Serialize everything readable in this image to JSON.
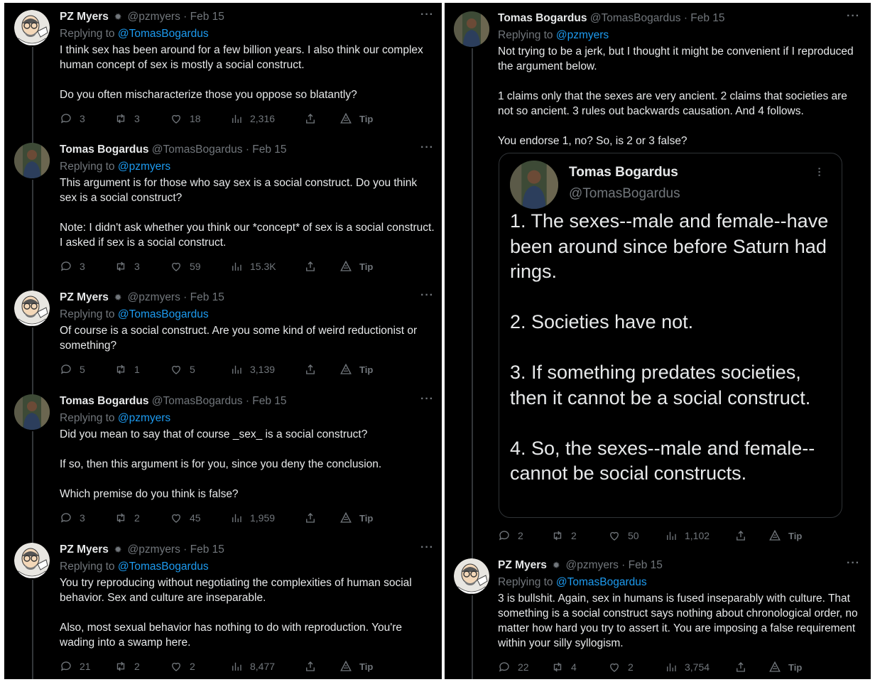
{
  "left_column": {
    "tweets": [
      {
        "name": "PZ Myers",
        "badge": "spider-icon",
        "handle": "@pzmyers",
        "date": "Feb 15",
        "replying_label": "Replying to",
        "replying_to": "@TomasBogardus",
        "body": [
          "I think sex has been around for a few billion years. I also think our complex human concept of sex is mostly a social construct.",
          "Do you often mischaracterize those you oppose so blatantly?"
        ],
        "replies": "3",
        "retweets": "3",
        "likes": "18",
        "views": "2,316",
        "tip": "Tip"
      },
      {
        "name": "Tomas Bogardus",
        "badge": "",
        "handle": "@TomasBogardus",
        "date": "Feb 15",
        "replying_label": "Replying to",
        "replying_to": "@pzmyers",
        "body": [
          "This argument is for those who say sex is a social construct. Do you think sex is a social construct?",
          "Note: I didn't ask whether you think our *concept* of sex is a social construct. I asked if sex is a social construct."
        ],
        "replies": "3",
        "retweets": "3",
        "likes": "59",
        "views": "15.3K",
        "tip": "Tip"
      },
      {
        "name": "PZ Myers",
        "badge": "spider-icon",
        "handle": "@pzmyers",
        "date": "Feb 15",
        "replying_label": "Replying to",
        "replying_to": "@TomasBogardus",
        "body": [
          "Of course is a social construct. Are you some kind of weird reductionist or something?"
        ],
        "replies": "5",
        "retweets": "1",
        "likes": "5",
        "views": "3,139",
        "tip": "Tip"
      },
      {
        "name": "Tomas Bogardus",
        "badge": "",
        "handle": "@TomasBogardus",
        "date": "Feb 15",
        "replying_label": "Replying to",
        "replying_to": "@pzmyers",
        "body": [
          "Did you mean to say that of course _sex_ is a social construct?",
          "If so, then this argument is for you, since you deny the conclusion.",
          "Which premise do you think is false?"
        ],
        "replies": "3",
        "retweets": "2",
        "likes": "45",
        "views": "1,959",
        "tip": "Tip"
      },
      {
        "name": "PZ Myers",
        "badge": "spider-icon",
        "handle": "@pzmyers",
        "date": "Feb 15",
        "replying_label": "Replying to",
        "replying_to": "@TomasBogardus",
        "body": [
          "You try reproducing without negotiating the complexities of human social behavior. Sex and culture are inseparable.",
          "Also, most sexual behavior has nothing to do with reproduction. You're wading into a swamp here."
        ],
        "replies": "21",
        "retweets": "2",
        "likes": "2",
        "views": "8,477",
        "tip": "Tip"
      }
    ]
  },
  "right_column": {
    "tweets": [
      {
        "name": "Tomas Bogardus",
        "badge": "",
        "handle": "@TomasBogardus",
        "date": "Feb 15",
        "replying_label": "Replying to",
        "replying_to": "@pzmyers",
        "body": [
          "Not trying to be a jerk, but I thought it might be convenient if I reproduced the argument below.",
          "1 claims only that the sexes are very ancient. 2 claims that societies are not so ancient. 3 rules out backwards causation. And 4 follows.",
          "You endorse 1, no? So, is 2 or 3 false?"
        ],
        "replies": "2",
        "retweets": "2",
        "likes": "50",
        "views": "1,102",
        "tip": "Tip"
      },
      {
        "name": "PZ Myers",
        "badge": "spider-icon",
        "handle": "@pzmyers",
        "date": "Feb 15",
        "replying_label": "Replying to",
        "replying_to": "@TomasBogardus",
        "body": [
          "3 is bullshit. Again, sex in humans is fused inseparably with culture. That something is a social construct says nothing about chronological order, no matter how hard you try to assert it. You are imposing a false requirement within your silly syllogism."
        ],
        "replies": "22",
        "retweets": "4",
        "likes": "2",
        "views": "3,754",
        "tip": "Tip"
      }
    ],
    "quote_card": {
      "name": "Tomas Bogardus",
      "handle": "@TomasBogardus",
      "premises": [
        "1. The sexes--male and female--have been around since before Saturn had rings.",
        "2. Societies have not.",
        "3. If something predates societies, then it cannot be a social construct.",
        "4. So, the sexes--male and female--cannot be social constructs."
      ]
    }
  },
  "colors": {
    "background": "#000000",
    "text": "#e7e9ea",
    "muted": "#71767b",
    "link": "#1d9bf0",
    "border": "#2f3336"
  }
}
